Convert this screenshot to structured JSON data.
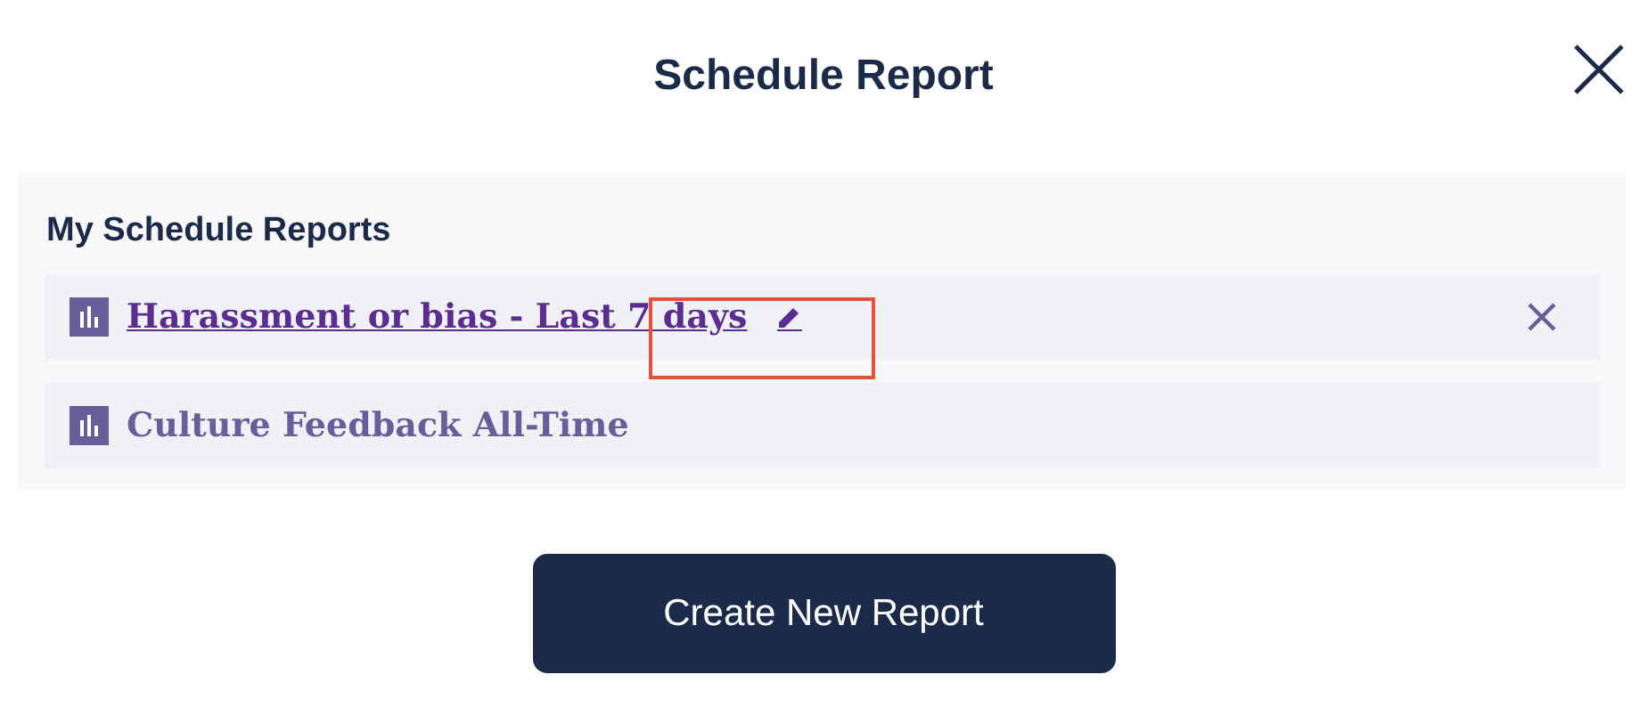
{
  "dialog": {
    "title": "Schedule Report"
  },
  "section": {
    "heading": "My Schedule Reports"
  },
  "reports": [
    {
      "name": "Harassment or bias - Last 7 days",
      "selected": true
    },
    {
      "name": "Culture Feedback All-Time",
      "selected": false
    }
  ],
  "buttons": [
    "Create New Report"
  ]
}
